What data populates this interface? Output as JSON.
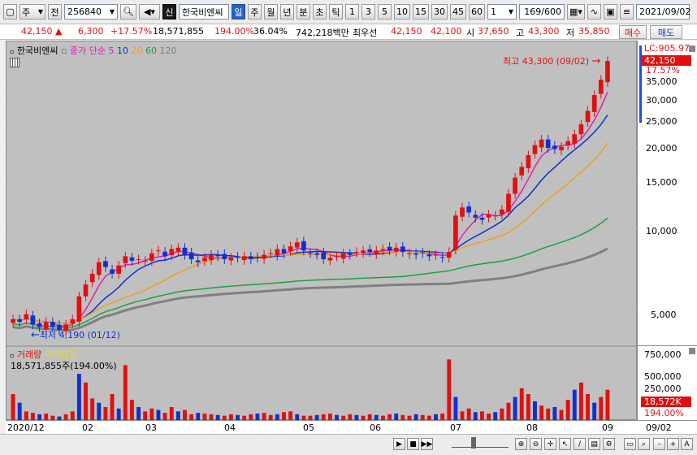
{
  "toolbar": {
    "market": "주",
    "jeon": "전",
    "code": "256840",
    "sin": "신",
    "name": "한국비엔씨",
    "periods": [
      "일",
      "주",
      "월",
      "년"
    ],
    "intraday": [
      "분",
      "초",
      "틱"
    ],
    "minutes": [
      "1",
      "3",
      "5",
      "10",
      "15",
      "30",
      "45",
      "60"
    ],
    "step": "1",
    "count": "169",
    "count_total": "/600",
    "date": "2021/09/02"
  },
  "quote": {
    "price": "42,150 ▲",
    "change": "6,300",
    "change_pct": "+17.57%",
    "volume": "18,571,855",
    "vol_ratio": "194.00%",
    "turnover": "36.04%",
    "amount": "742,218백만",
    "best_bid_label": "최우선",
    "best_ask": "42,150",
    "best_bid": "42,100",
    "open_label": "시",
    "open": "37,650",
    "high_label": "고",
    "high": "43,300",
    "low_label": "저",
    "low": "35,850",
    "buy_label": "매수",
    "sell_label": "매도"
  },
  "chart_data": {
    "type": "candlestick",
    "stock_name": "한국비엔씨",
    "legend": {
      "prefix": "종가 단순",
      "ma": [
        "5",
        "10",
        "20",
        "60",
        "120"
      ],
      "colors": [
        "#e020b0",
        "#1030d0",
        "#f0a020",
        "#20a040",
        "#808080"
      ]
    },
    "high_note": "최고 43,300 (09/02)",
    "low_note": "최저 4,190 (01/12)",
    "price_axis": [
      "LC:905.97",
      "42,150",
      "17.57%",
      "35,000",
      "30,000",
      "25,000",
      "20,000",
      "15,000",
      "10,000",
      "5,000"
    ],
    "volume_legend": [
      "거래량",
      "거래대금"
    ],
    "volume_value": "18,571,855주(194.00%)",
    "volume_axis": [
      "750,000",
      "500,000",
      "250,000",
      "18,572K",
      "194.00%"
    ],
    "x_labels": [
      "2020/12",
      "02",
      "03",
      "04",
      "05",
      "06",
      "07",
      "08",
      "09",
      "09/02"
    ],
    "series_close": [
      4.6,
      4.5,
      4.8,
      4.4,
      4.3,
      4.5,
      4.3,
      4.2,
      4.4,
      4.6,
      5.6,
      6.2,
      6.8,
      7.5,
      7.2,
      6.8,
      7.3,
      7.9,
      7.6,
      7.7,
      7.6,
      8.1,
      8.3,
      7.9,
      8.4,
      8.5,
      8.0,
      7.7,
      7.5,
      7.8,
      8.0,
      7.9,
      7.7,
      7.8,
      7.8,
      7.9,
      7.7,
      7.8,
      8.0,
      8.1,
      8.4,
      8.1,
      8.6,
      8.9,
      8.3,
      8.1,
      8.0,
      7.7,
      7.8,
      7.9,
      8.1,
      8.0,
      8.2,
      8.3,
      8.2,
      8.3,
      8.4,
      8.3,
      8.5,
      8.2,
      8.1,
      8.0,
      8.1,
      7.9,
      8.0,
      7.8,
      8.2,
      11.2,
      12.0,
      11.5,
      11.0,
      10.8,
      11.3,
      11.2,
      11.8,
      13.5,
      15.5,
      17.0,
      18.8,
      20.5,
      21.5,
      20.0,
      19.8,
      20.2,
      21.2,
      22.5,
      24.5,
      27.5,
      31.5,
      35.9,
      42.15
    ],
    "volume_bars": [
      180,
      120,
      60,
      50,
      40,
      45,
      30,
      25,
      40,
      60,
      320,
      260,
      150,
      120,
      90,
      180,
      80,
      380,
      140,
      90,
      60,
      80,
      70,
      50,
      90,
      60,
      70,
      40,
      50,
      45,
      40,
      35,
      30,
      40,
      35,
      30,
      40,
      45,
      50,
      35,
      40,
      55,
      60,
      40,
      30,
      30,
      35,
      40,
      45,
      35,
      30,
      40,
      35,
      30,
      40,
      35,
      30,
      40,
      45,
      35,
      30,
      40,
      35,
      30,
      40,
      45,
      420,
      160,
      60,
      80,
      55,
      60,
      45,
      55,
      80,
      120,
      160,
      220,
      180,
      130,
      100,
      80,
      90,
      70,
      140,
      210,
      260,
      180,
      120,
      160,
      210
    ]
  },
  "bottom_bar": [
    "▶",
    "■",
    "▶▶",
    "-",
    "+",
    "A"
  ]
}
